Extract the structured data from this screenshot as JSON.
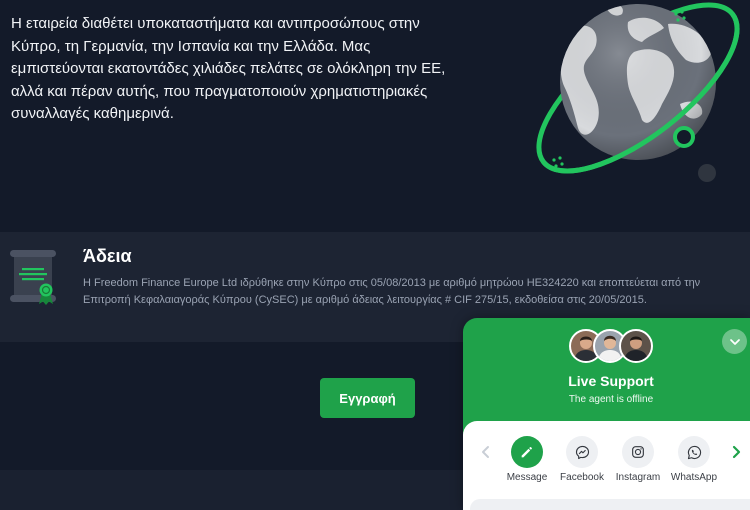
{
  "colors": {
    "background": "#131a29",
    "band": "#1d2433",
    "footer": "#1a2130",
    "accent": "#1fa24a",
    "ring": "#22c55e"
  },
  "about": {
    "text": "Η εταιρεία διαθέτει υποκαταστήματα και αντιπροσώπους στην Κύπρο, τη Γερμανία, την Ισπανία και την Ελλάδα. Μας εμπιστεύονται εκατοντάδες χιλιάδες πελάτες σε ολόκληρη την ΕΕ, αλλά και πέραν αυτής, που πραγματοποιούν χρηματιστηριακές συναλλαγές καθημερινά.",
    "illustration": "globe-illustration"
  },
  "license": {
    "icon": "certificate-icon",
    "title": "Άδεια",
    "text": "Η Freedom Finance Europe Ltd ιδρύθηκε στην Κύπρο στις 05/08/2013 με αριθμό μητρώου HE324220 και εποπτεύεται από την Επιτροπή Κεφαλαιαγοράς Κύπρου (CySEC) με αριθμό άδειας λειτουργίας # CIF 275/15, εκδοθείσα στις 20/05/2015."
  },
  "signup": {
    "label": "Εγγραφή"
  },
  "chat": {
    "title": "Live Support",
    "status": "The agent is offline",
    "collapse_icon": "chevron-down-icon",
    "prev_icon": "chevron-left-icon",
    "next_icon": "chevron-right-icon",
    "channels": [
      {
        "label": "Message",
        "icon": "pencil-icon"
      },
      {
        "label": "Facebook",
        "icon": "messenger-icon"
      },
      {
        "label": "Instagram",
        "icon": "instagram-icon"
      },
      {
        "label": "WhatsApp",
        "icon": "whatsapp-icon"
      }
    ]
  }
}
